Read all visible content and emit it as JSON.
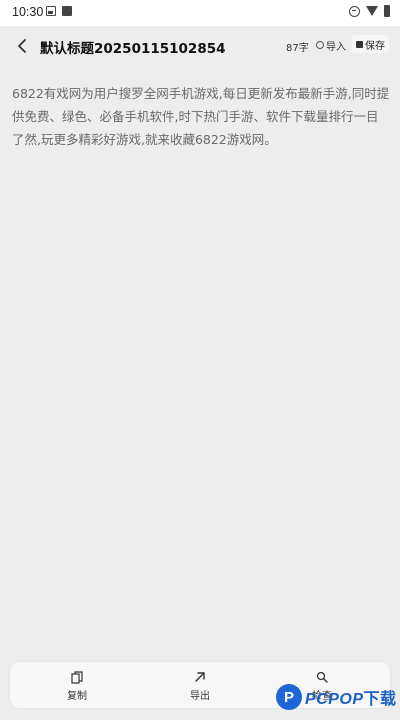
{
  "status_bar": {
    "time": "10:30",
    "icons": [
      "image-icon",
      "square-icon",
      "minus-circle-icon",
      "wifi-icon",
      "battery-icon"
    ]
  },
  "header": {
    "title": "默认标题20250115102854",
    "word_count": "87字",
    "import_label": "导入",
    "save_label": "保存"
  },
  "editor": {
    "content": "6822有戏网为用户搜罗全网手机游戏,每日更新发布最新手游,同时提供免费、绿色、必备手机软件,时下热门手游、软件下载量排行一目了然,玩更多精彩好游戏,就来收藏6822游戏网。"
  },
  "bottom_bar": {
    "copy_label": "复制",
    "export_label": "导出",
    "check_label": "检查"
  },
  "watermark": {
    "brand": "PCPOP",
    "suffix": "下载"
  },
  "colors": {
    "background": "#ededed",
    "text_muted": "#6a6a6a",
    "watermark_blue": "#1e66d6"
  }
}
